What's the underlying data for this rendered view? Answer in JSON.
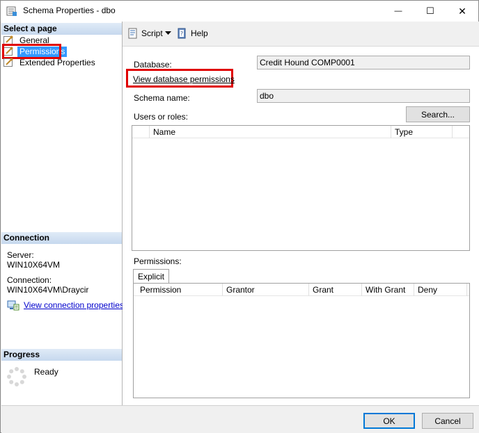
{
  "window": {
    "title": "Schema Properties - dbo",
    "minimize_glyph": "—",
    "maximize_glyph": "☐",
    "close_glyph": "✕"
  },
  "left": {
    "select_page_header": "Select a page",
    "pages": [
      {
        "label": "General",
        "icon": "wrench-page-icon"
      },
      {
        "label": "Permissions",
        "icon": "wrench-page-icon",
        "selected": true
      },
      {
        "label": "Extended Properties",
        "icon": "wrench-page-icon"
      }
    ],
    "connection_header": "Connection",
    "server_label": "Server:",
    "server_value": "WIN10X64VM",
    "connection_label": "Connection:",
    "connection_value": "WIN10X64VM\\Draycir",
    "view_connection_link": "View connection properties",
    "progress_header": "Progress",
    "progress_status": "Ready"
  },
  "toolbar": {
    "script_label": "Script",
    "help_label": "Help"
  },
  "main": {
    "database_label": "Database:",
    "database_value": "Credit Hound COMP0001",
    "view_db_permissions_link": "View database permissions",
    "schema_name_label": "Schema name:",
    "schema_name_value": "dbo",
    "users_roles_label": "Users or roles:",
    "search_button": "Search...",
    "users_columns": [
      "Name",
      "Type"
    ],
    "permissions_label": "Permissions:",
    "explicit_tab": "Explicit",
    "permission_columns": [
      "Permission",
      "Grantor",
      "Grant",
      "With Grant",
      "Deny"
    ]
  },
  "footer": {
    "ok_label": "OK",
    "cancel_label": "Cancel"
  },
  "colors": {
    "highlight_red": "#e00000",
    "selection_blue": "#3399ff",
    "link_blue": "#0000cc",
    "default_button_border": "#0078d7"
  }
}
